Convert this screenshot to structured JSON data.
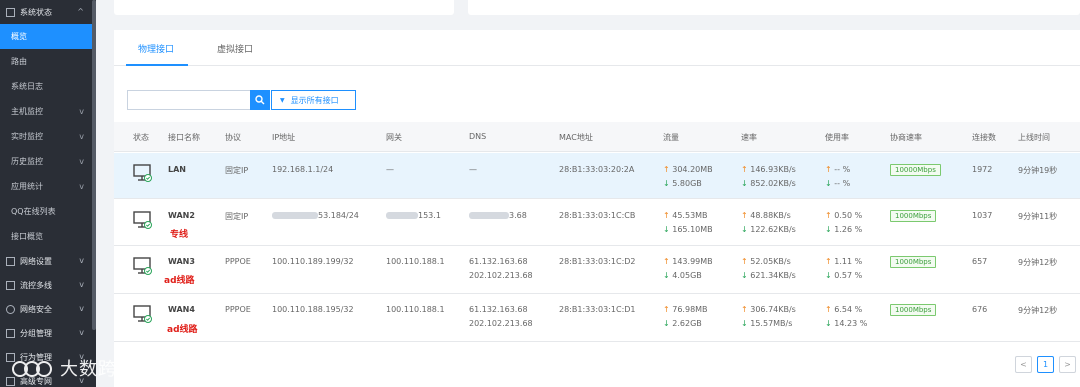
{
  "sidebar": {
    "groups_top": {
      "label": "系统状态",
      "chev": "^"
    },
    "items": [
      {
        "label": "概览",
        "active": true,
        "chev": ""
      },
      {
        "label": "路由",
        "active": false,
        "chev": ""
      },
      {
        "label": "系统日志",
        "active": false,
        "chev": ""
      },
      {
        "label": "主机监控",
        "active": false,
        "chev": "v"
      },
      {
        "label": "实时监控",
        "active": false,
        "chev": "v"
      },
      {
        "label": "历史监控",
        "active": false,
        "chev": "v"
      },
      {
        "label": "应用统计",
        "active": false,
        "chev": "v"
      },
      {
        "label": "QQ在线列表",
        "active": false,
        "chev": ""
      },
      {
        "label": "接口概览",
        "active": false,
        "chev": ""
      }
    ],
    "groups": [
      {
        "label": "网络设置",
        "chev": "v"
      },
      {
        "label": "流控多线",
        "chev": "v"
      },
      {
        "label": "网络安全",
        "chev": "v"
      },
      {
        "label": "分组管理",
        "chev": "v"
      },
      {
        "label": "行为管理",
        "chev": "v"
      },
      {
        "label": "高级专网",
        "chev": "v"
      }
    ]
  },
  "tabs": {
    "physical": "物理接口",
    "virtual": "虚拟接口"
  },
  "search": {
    "placeholder": "",
    "filter_label": "显示所有接口"
  },
  "table": {
    "headers": [
      "状态",
      "接口名称",
      "协议",
      "IP地址",
      "网关",
      "DNS",
      "MAC地址",
      "流量",
      "速率",
      "使用率",
      "协商速率",
      "连接数",
      "上线时间"
    ],
    "rows": [
      {
        "name": "LAN",
        "note": "",
        "protocol": "固定IP",
        "ip": "192.168.1.1/24",
        "gateway": "—",
        "dns1": "—",
        "dns2": "",
        "mac": "28:B1:33:03:20:2A",
        "traffic_up": "304.20MB",
        "traffic_down": "5.80GB",
        "rate_up": "146.93KB/s",
        "rate_down": "852.02KB/s",
        "usage_up": "-- %",
        "usage_down": "-- %",
        "speed": "10000Mbps",
        "conns": "1972",
        "uptime": "9分钟19秒",
        "highlight": true
      },
      {
        "name": "WAN2",
        "note": "专线",
        "protocol": "固定IP",
        "ip": "53.184/24",
        "gateway": "153.1",
        "dns1": "3.68",
        "dns2": "",
        "mac": "28:B1:33:03:1C:CB",
        "traffic_up": "45.53MB",
        "traffic_down": "165.10MB",
        "rate_up": "48.88KB/s",
        "rate_down": "122.62KB/s",
        "usage_up": "0.50 %",
        "usage_down": "1.26 %",
        "speed": "1000Mbps",
        "conns": "1037",
        "uptime": "9分钟11秒",
        "highlight": false
      },
      {
        "name": "WAN3",
        "note": "ad线路",
        "protocol": "PPPOE",
        "ip": "100.110.189.199/32",
        "gateway": "100.110.188.1",
        "dns1": "61.132.163.68",
        "dns2": "202.102.213.68",
        "mac": "28:B1:33:03:1C:D2",
        "traffic_up": "143.99MB",
        "traffic_down": "4.05GB",
        "rate_up": "52.05KB/s",
        "rate_down": "621.34KB/s",
        "usage_up": "1.11 %",
        "usage_down": "0.57 %",
        "speed": "1000Mbps",
        "conns": "657",
        "uptime": "9分钟12秒",
        "highlight": false
      },
      {
        "name": "WAN4",
        "note": "ad线路",
        "protocol": "PPPOE",
        "ip": "100.110.188.195/32",
        "gateway": "100.110.188.1",
        "dns1": "61.132.163.68",
        "dns2": "202.102.213.68",
        "mac": "28:B1:33:03:1C:D1",
        "traffic_up": "76.98MB",
        "traffic_down": "2.62GB",
        "rate_up": "306.74KB/s",
        "rate_down": "15.57MB/s",
        "usage_up": "6.54 %",
        "usage_down": "14.23 %",
        "speed": "1000Mbps",
        "conns": "676",
        "uptime": "9分钟12秒",
        "highlight": false
      }
    ]
  },
  "pagination": {
    "prev": "<",
    "current": "1",
    "next": ">"
  },
  "watermark": {
    "text": "大数跨境"
  },
  "colors": {
    "accent": "#1e90ff",
    "up": "#f08a24",
    "down": "#2aa55a",
    "note": "#e0201a"
  }
}
